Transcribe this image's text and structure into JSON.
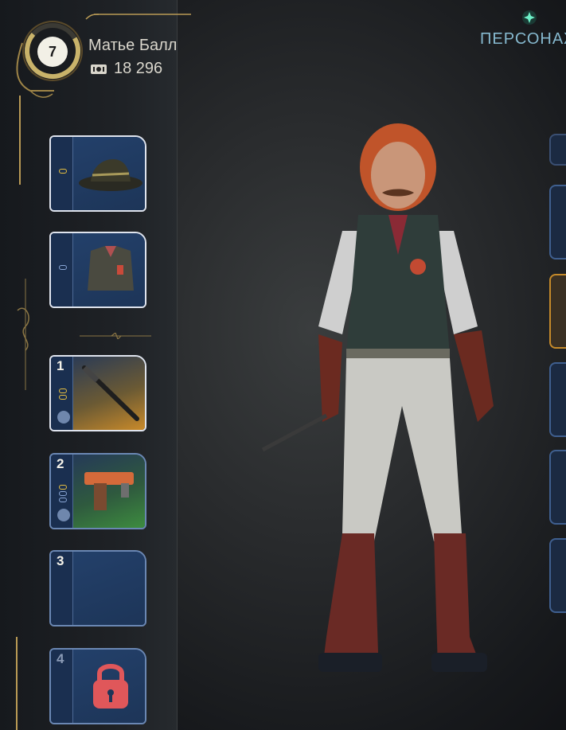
{
  "player": {
    "level": "7",
    "name": "Матье Балл",
    "currency": "18 296",
    "currency_icon": "ticket-icon"
  },
  "tabs": {
    "active_label": "ПЕРСОНАЖ"
  },
  "slots": [
    {
      "type": "hat",
      "number": "",
      "icon": "hat-icon"
    },
    {
      "type": "vest",
      "number": "",
      "icon": "vest-icon"
    },
    {
      "type": "melee",
      "number": "1",
      "icon": "baton-icon"
    },
    {
      "type": "pistol",
      "number": "2",
      "icon": "pistol-icon"
    },
    {
      "type": "empty",
      "number": "3",
      "icon": ""
    },
    {
      "type": "locked",
      "number": "4",
      "icon": "lock-icon"
    }
  ],
  "colors": {
    "accent_gold": "#b99a55",
    "slot_blue": "#1d3558",
    "rarity_gold": "#c98a2a",
    "rarity_green": "#3d8c3f",
    "lock_red": "#e0575a",
    "tab_text": "#86b9cf"
  }
}
